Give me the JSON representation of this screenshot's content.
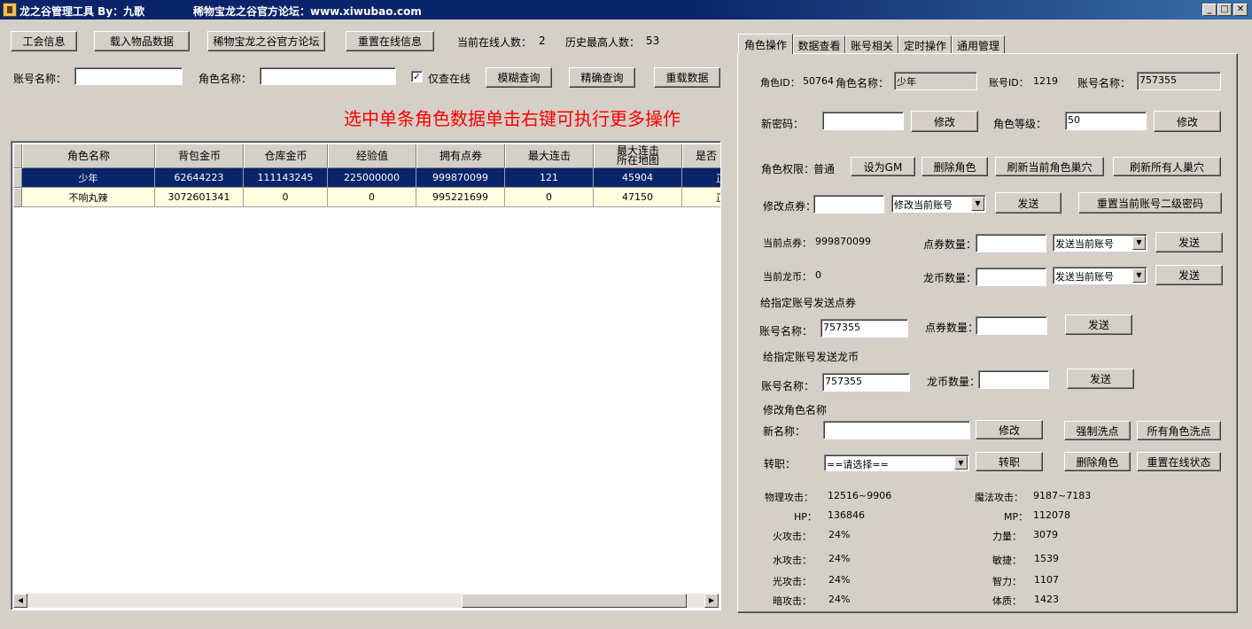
{
  "window": {
    "title": "龙之谷管理工具 By：九歌",
    "forum": "稀物宝龙之谷官方论坛：www.xiwubao.com",
    "min": "_",
    "max": "□",
    "close": "✕"
  },
  "toolbar": {
    "guild_info": "工会信息",
    "load_items": "载入物品数据",
    "forum_btn": "稀物宝龙之谷官方论坛",
    "reset_online": "重置在线信息",
    "online_label": "当前在线人数：",
    "online_value": "2",
    "max_label": "历史最高人数：",
    "max_value": "53"
  },
  "search": {
    "account_label": "账号名称：",
    "role_label": "角色名称：",
    "account_value": "",
    "role_value": "",
    "only_online_label": "仅查在线",
    "only_online_check": "✓",
    "fuzzy": "模糊查询",
    "exact": "精确查询",
    "reload": "重载数据"
  },
  "hint": "选中单条角色数据单击右键可执行更多操作",
  "grid": {
    "headers": [
      "角色名称",
      "背包金币",
      "仓库金币",
      "经验值",
      "拥有点券",
      "最大连击",
      "最大连击所在地图",
      "是否"
    ],
    "rows": [
      [
        "少年",
        "62644223",
        "111143245",
        "225000000",
        "999870099",
        "121",
        "45904",
        "正"
      ],
      [
        "不响丸辣",
        "3072601341",
        "0",
        "0",
        "995221699",
        "0",
        "47150",
        "正"
      ]
    ],
    "scroll_left": "◀",
    "scroll_right": "▶"
  },
  "tabs": [
    "角色操作",
    "数据查看",
    "账号相关",
    "定时操作",
    "通用管理"
  ],
  "panel": {
    "role_id_label": "角色ID：",
    "role_id": "50764",
    "role_name_label": "角色名称：",
    "role_name": "少年",
    "account_id_label": "账号ID：",
    "account_id": "1219",
    "account_name_label": "账号名称：",
    "account_name": "757355",
    "new_pwd_label": "新密码：",
    "new_pwd": "",
    "modify": "修改",
    "role_level_label": "角色等级：",
    "role_level": "50",
    "perm_label": "角色权限：",
    "perm_value": "普通",
    "set_gm": "设为GM",
    "delete_role": "删除角色",
    "refresh_cur_nest": "刷新当前角色巢穴",
    "refresh_all_nest": "刷新所有人巢穴",
    "modify_points_label": "修改点券：",
    "modify_points_value": "",
    "modify_account_combo": "修改当前账号",
    "send": "发送",
    "reset_pwd2": "重置当前账号二级密码",
    "cur_points_label": "当前点券：",
    "cur_points": "999870099",
    "points_qty_label": "点券数量：",
    "points_qty": "",
    "send_account_combo": "发送当前账号",
    "cur_dragon_label": "当前龙币：",
    "cur_dragon": "0",
    "dragon_qty_label": "龙币数量：",
    "dragon_qty": "",
    "give_points_title": "给指定账号发送点券",
    "acc_name_label": "账号名称：",
    "acc_name_1": "757355",
    "points_qty2_label": "点券数量：",
    "points_qty2": "",
    "give_dragon_title": "给指定账号发送龙币",
    "acc_name_2": "757355",
    "dragon_qty2_label": "龙币数量：",
    "dragon_qty2": "",
    "rename_title": "修改角色名称",
    "new_name_label": "新名称：",
    "new_name": "",
    "force_wash": "强制洗点",
    "all_wash": "所有角色洗点",
    "job_label": "转职：",
    "job_combo": "==请选择==",
    "job_btn": "转职",
    "reset_online_state": "重置在线状态",
    "stats": {
      "phys_atk_label": "物理攻击：",
      "phys_atk": "12516~9906",
      "magic_atk_label": "魔法攻击：",
      "magic_atk": "9187~7183",
      "hp_label": "HP：",
      "hp": "136846",
      "mp_label": "MP：",
      "mp": "112078",
      "fire_label": "火攻击：",
      "fire": "24%",
      "str_label": "力量：",
      "str": "3079",
      "water_label": "水攻击：",
      "water": "24%",
      "agi_label": "敏捷：",
      "agi": "1539",
      "light_label": "光攻击：",
      "light": "24%",
      "int_label": "智力：",
      "int": "1107",
      "dark_label": "暗攻击：",
      "dark": "24%",
      "vit_label": "体质：",
      "vit": "1423"
    }
  },
  "colors": {
    "titlebar": "#0a246a",
    "hint": "#ff0000",
    "selected_row": "#0a246a",
    "normal_row": "#ffffe1"
  }
}
